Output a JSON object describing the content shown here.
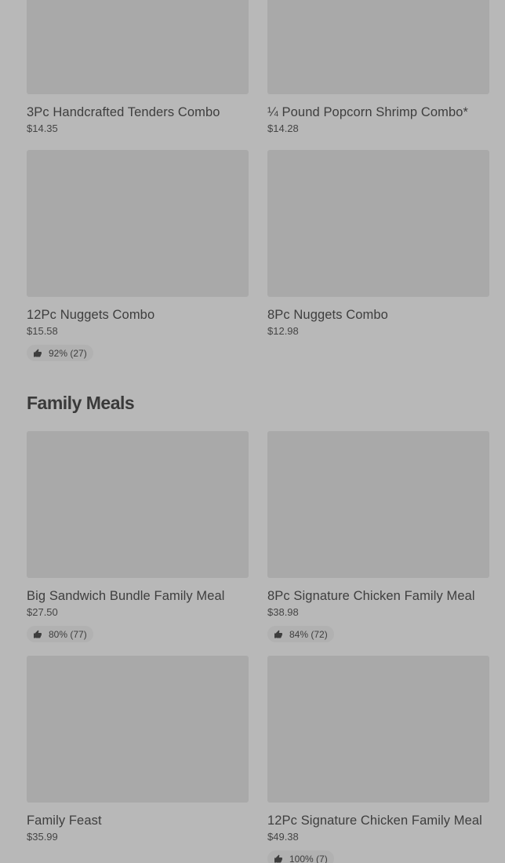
{
  "top_section": {
    "items": [
      {
        "name": "3Pc Handcrafted Tenders Combo",
        "price": "$14.35",
        "rating": ""
      },
      {
        "name": "¼ Pound Popcorn Shrimp Combo*",
        "price": "$14.28",
        "rating": ""
      },
      {
        "name": "12Pc Nuggets Combo",
        "price": "$15.58",
        "rating": "92% (27)"
      },
      {
        "name": "8Pc Nuggets Combo",
        "price": "$12.98",
        "rating": ""
      }
    ]
  },
  "family_meals": {
    "title": "Family Meals",
    "items": [
      {
        "name": "Big Sandwich Bundle Family Meal",
        "price": "$27.50",
        "rating": "80% (77)"
      },
      {
        "name": "8Pc Signature Chicken Family Meal",
        "price": "$38.98",
        "rating": "84% (72)"
      },
      {
        "name": "Family Feast",
        "price": "$35.99",
        "rating": ""
      },
      {
        "name": "12Pc Signature Chicken Family Meal",
        "price": "$49.38",
        "rating": "100% (7)"
      }
    ]
  },
  "icons": {
    "rating": "thumbs-up-icon"
  },
  "colors": {
    "overlay_background": "#b8b8b8",
    "image_placeholder": "#a9a9a9",
    "text": "#3e3e3e"
  }
}
